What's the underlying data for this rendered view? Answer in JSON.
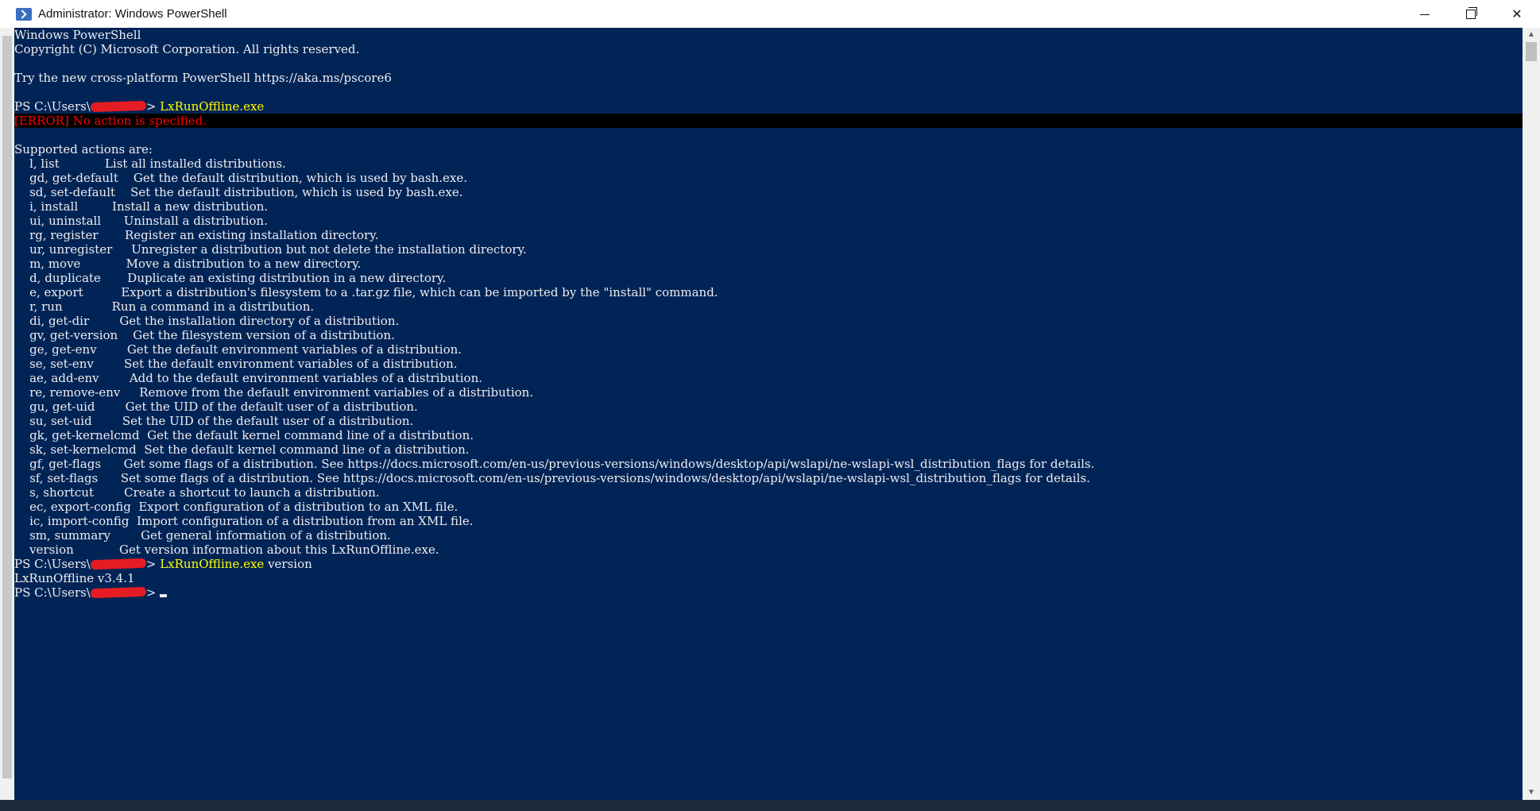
{
  "window": {
    "title": "Administrator: Windows PowerShell",
    "minimize_label": "",
    "restore_label": "",
    "close_label": "✕"
  },
  "console": {
    "header": [
      "Windows PowerShell",
      "Copyright (C) Microsoft Corporation. All rights reserved.",
      "",
      "Try the new cross-platform PowerShell https://aka.ms/pscore6",
      ""
    ],
    "prompt_prefix": "PS C:\\Users\\",
    "prompt_suffix": "> ",
    "command1": "LxRunOffline.exe",
    "error": "[ERROR] No action is specified.",
    "supported_heading": "Supported actions are:",
    "actions": [
      {
        "cmd": "    l, list            ",
        "desc": "List all installed distributions."
      },
      {
        "cmd": "    gd, get-default    ",
        "desc": "Get the default distribution, which is used by bash.exe."
      },
      {
        "cmd": "    sd, set-default    ",
        "desc": "Set the default distribution, which is used by bash.exe."
      },
      {
        "cmd": "    i, install         ",
        "desc": "Install a new distribution."
      },
      {
        "cmd": "    ui, uninstall      ",
        "desc": "Uninstall a distribution."
      },
      {
        "cmd": "    rg, register       ",
        "desc": "Register an existing installation directory."
      },
      {
        "cmd": "    ur, unregister     ",
        "desc": "Unregister a distribution but not delete the installation directory."
      },
      {
        "cmd": "    m, move            ",
        "desc": "Move a distribution to a new directory."
      },
      {
        "cmd": "    d, duplicate       ",
        "desc": "Duplicate an existing distribution in a new directory."
      },
      {
        "cmd": "    e, export          ",
        "desc": "Export a distribution's filesystem to a .tar.gz file, which can be imported by the \"install\" command."
      },
      {
        "cmd": "    r, run             ",
        "desc": "Run a command in a distribution."
      },
      {
        "cmd": "    di, get-dir        ",
        "desc": "Get the installation directory of a distribution."
      },
      {
        "cmd": "    gv, get-version    ",
        "desc": "Get the filesystem version of a distribution."
      },
      {
        "cmd": "    ge, get-env        ",
        "desc": "Get the default environment variables of a distribution."
      },
      {
        "cmd": "    se, set-env        ",
        "desc": "Set the default environment variables of a distribution."
      },
      {
        "cmd": "    ae, add-env        ",
        "desc": "Add to the default environment variables of a distribution."
      },
      {
        "cmd": "    re, remove-env     ",
        "desc": "Remove from the default environment variables of a distribution."
      },
      {
        "cmd": "    gu, get-uid        ",
        "desc": "Get the UID of the default user of a distribution."
      },
      {
        "cmd": "    su, set-uid        ",
        "desc": "Set the UID of the default user of a distribution."
      },
      {
        "cmd": "    gk, get-kernelcmd  ",
        "desc": "Get the default kernel command line of a distribution."
      },
      {
        "cmd": "    sk, set-kernelcmd  ",
        "desc": "Set the default kernel command line of a distribution."
      },
      {
        "cmd": "    gf, get-flags      ",
        "desc": "Get some flags of a distribution. See https://docs.microsoft.com/en-us/previous-versions/windows/desktop/api/wslapi/ne-wslapi-wsl_distribution_flags for details."
      },
      {
        "cmd": "    sf, set-flags      ",
        "desc": "Set some flags of a distribution. See https://docs.microsoft.com/en-us/previous-versions/windows/desktop/api/wslapi/ne-wslapi-wsl_distribution_flags for details."
      },
      {
        "cmd": "    s, shortcut        ",
        "desc": "Create a shortcut to launch a distribution."
      },
      {
        "cmd": "    ec, export-config  ",
        "desc": "Export configuration of a distribution to an XML file."
      },
      {
        "cmd": "    ic, import-config  ",
        "desc": "Import configuration of a distribution from an XML file."
      },
      {
        "cmd": "    sm, summary        ",
        "desc": "Get general information of a distribution."
      },
      {
        "cmd": "    version            ",
        "desc": "Get version information about this LxRunOffline.exe."
      }
    ],
    "command2": "LxRunOffline.exe",
    "command2_arg": " version",
    "version_output": "LxRunOffline v3.4.1"
  },
  "colors": {
    "console_bg": "#012456",
    "text": "#eeedf0",
    "command": "#ffff00",
    "error": "#ff0000"
  }
}
